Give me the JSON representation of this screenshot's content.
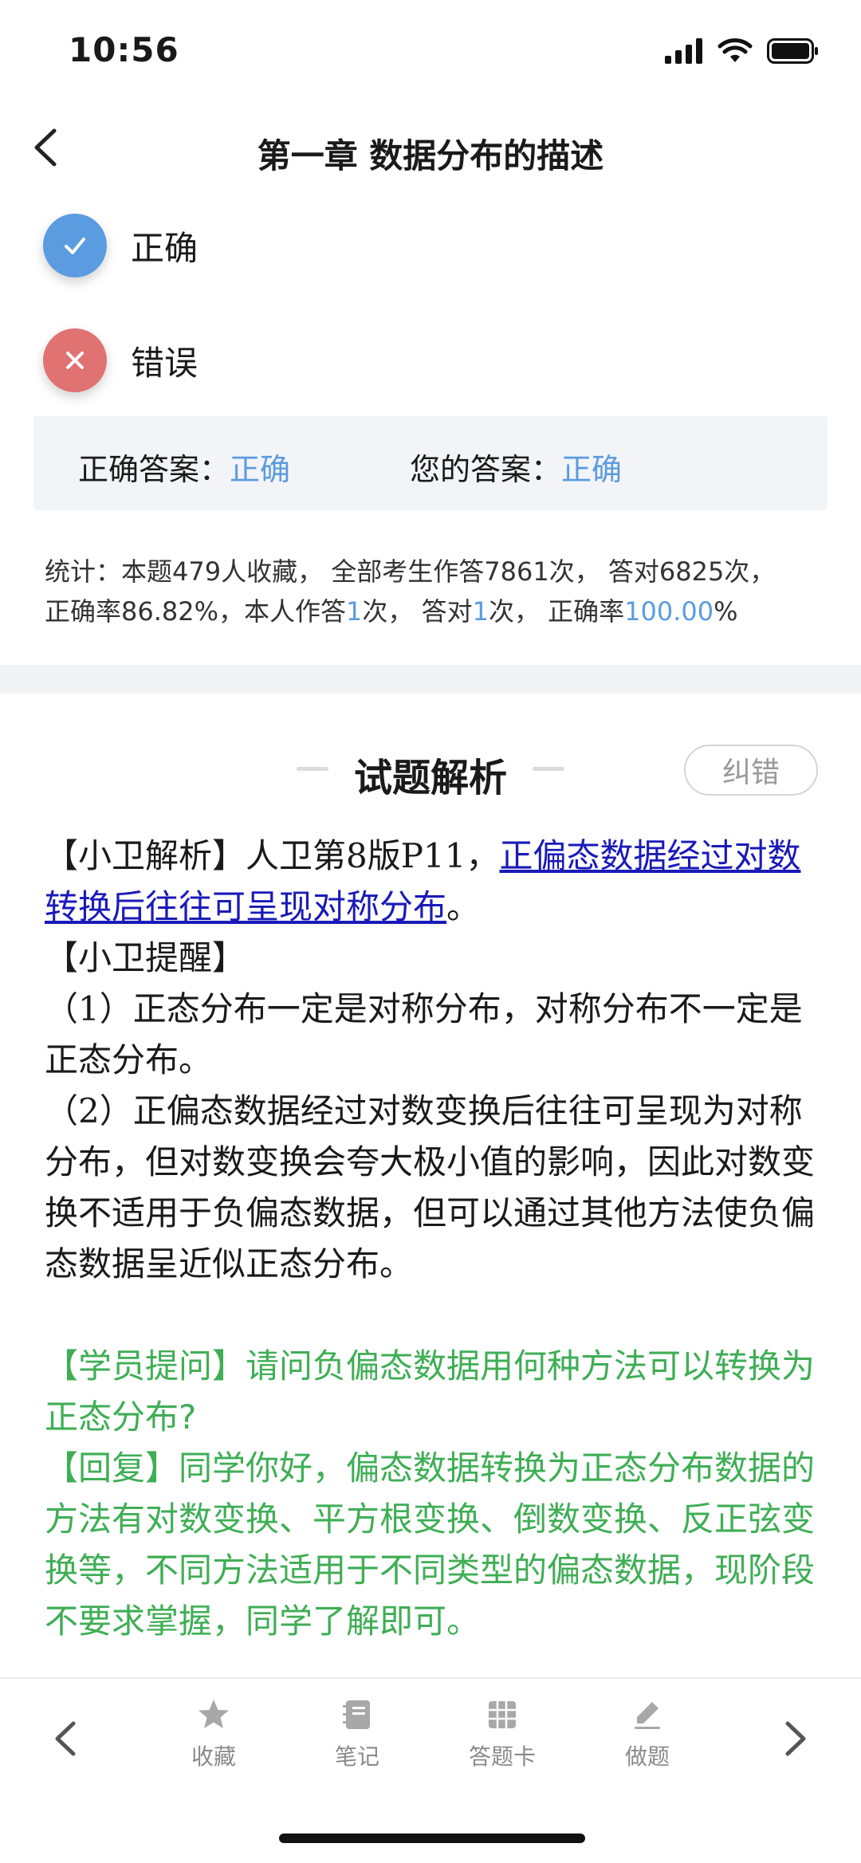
{
  "status_bar": {
    "time": "10:56"
  },
  "header": {
    "title": "第一章 数据分布的描述"
  },
  "options": [
    {
      "label": "正确",
      "state": "selected-correct",
      "color": "#5b9be0"
    },
    {
      "label": "错误",
      "state": "wrong",
      "color": "#e07272"
    }
  ],
  "answer": {
    "correct_label": "正确答案：",
    "correct_value": "正确",
    "yours_label": "您的答案：",
    "yours_value": "正确"
  },
  "stats": {
    "line1": "统计：本题479人收藏， 全部考生作答7861次， 答对6825次，",
    "line2_prefix": "正确率86.82%，本人作答",
    "my_attempts": "1",
    "mid1": "次， 答对",
    "my_correct": "1",
    "mid2": "次， 正确率",
    "my_rate": "100.00",
    "suffix": "%"
  },
  "analysis": {
    "title": "试题解析",
    "report_button": "纠错",
    "p1_prefix": "【小卫解析】人卫第8版P11，",
    "p1_link": "正偏态数据经过对数转换后往往可呈现对称分布",
    "p1_suffix": "。",
    "reminder_title": "【小卫提醒】",
    "reminder_1": "（1）正态分布一定是对称分布，对称分布不一定是正态分布。",
    "reminder_2": "（2）正偏态数据经过对数变换后往往可呈现为对称分布，但对数变换会夸大极小值的影响，因此对数变换不适用于负偏态数据，但可以通过其他方法使负偏态数据呈近似正态分布。",
    "student_q": "【学员提问】请问负偏态数据用何种方法可以转换为正态分布?",
    "reply": "【回复】同学你好，偏态数据转换为正态分布数据的方法有对数变换、平方根变换、倒数变换、反正弦变换等，不同方法适用于不同类型的偏态数据，现阶段不要求掌握，同学了解即可。"
  },
  "tabbar": {
    "items": [
      {
        "label": "收藏",
        "icon": "star-icon"
      },
      {
        "label": "笔记",
        "icon": "notebook-icon"
      },
      {
        "label": "答题卡",
        "icon": "grid-icon"
      },
      {
        "label": "做题",
        "icon": "pencil-icon"
      }
    ]
  },
  "colors": {
    "accent": "#5b9be0",
    "error": "#e07272",
    "green": "#3fae55",
    "link": "#1a1ab8"
  }
}
